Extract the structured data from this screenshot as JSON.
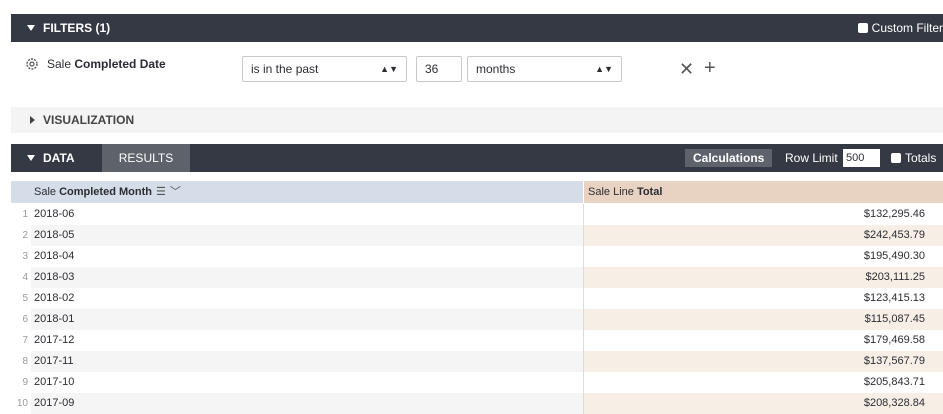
{
  "filters": {
    "title": "FILTERS (1)",
    "custom_filter_label": "Custom Filter",
    "field_prefix": "Sale ",
    "field_bold": "Completed Date",
    "operator": "is in the past",
    "value": "36",
    "unit": "months",
    "icons": {
      "settings": "gear-icon",
      "remove": "close-icon",
      "add": "plus-icon"
    }
  },
  "visualization": {
    "title": "VISUALIZATION"
  },
  "data_section": {
    "title": "DATA",
    "results_tab": "RESULTS",
    "calculations_label": "Calculations",
    "row_limit_label": "Row Limit",
    "row_limit_value": "500",
    "totals_label": "Totals"
  },
  "table": {
    "dim_header_prefix": "Sale ",
    "dim_header_bold": "Completed Month",
    "meas_header_prefix": "Sale Line ",
    "meas_header_bold": "Total",
    "rows": [
      {
        "n": "1",
        "month": "2018-06",
        "total": "$132,295.46"
      },
      {
        "n": "2",
        "month": "2018-05",
        "total": "$242,453.79"
      },
      {
        "n": "3",
        "month": "2018-04",
        "total": "$195,490.30"
      },
      {
        "n": "4",
        "month": "2018-03",
        "total": "$203,111.25"
      },
      {
        "n": "5",
        "month": "2018-02",
        "total": "$123,415.13"
      },
      {
        "n": "6",
        "month": "2018-01",
        "total": "$115,087.45"
      },
      {
        "n": "7",
        "month": "2017-12",
        "total": "$179,469.58"
      },
      {
        "n": "8",
        "month": "2017-11",
        "total": "$137,567.79"
      },
      {
        "n": "9",
        "month": "2017-10",
        "total": "$205,843.71"
      },
      {
        "n": "10",
        "month": "2017-09",
        "total": "$208,328.84"
      }
    ]
  }
}
